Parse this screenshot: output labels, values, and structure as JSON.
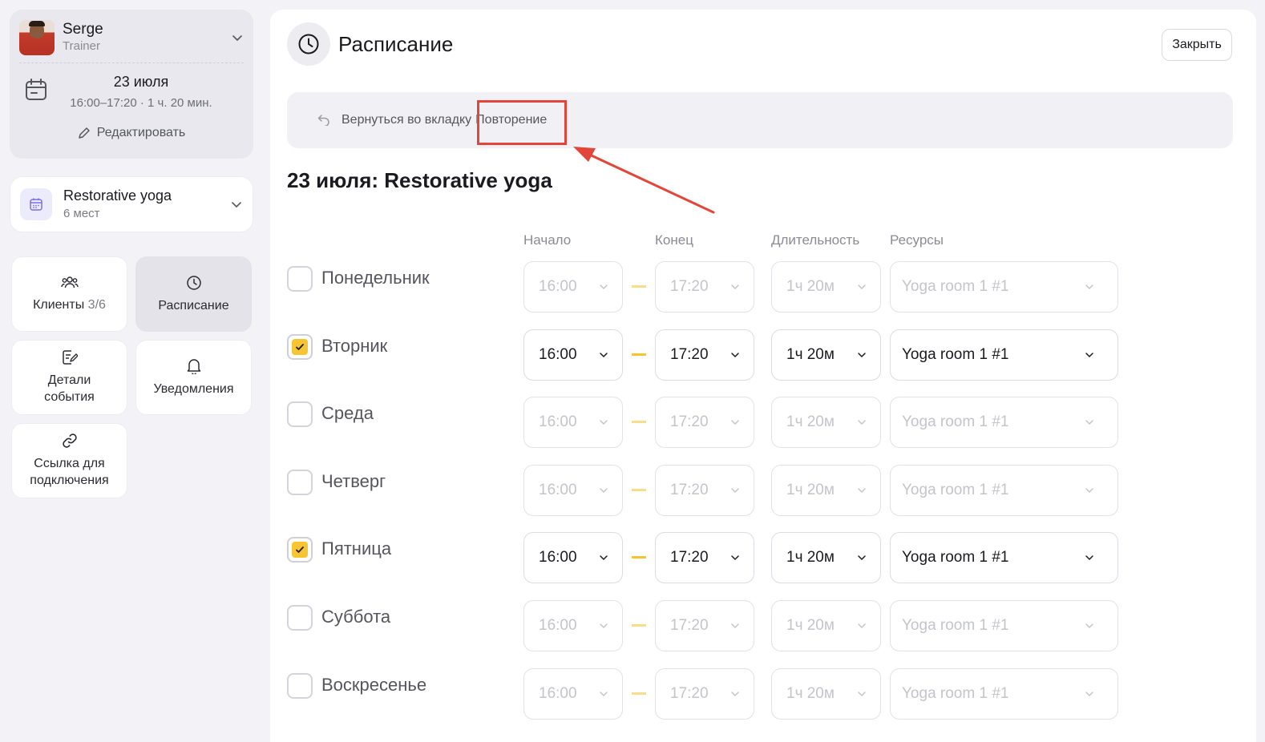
{
  "user": {
    "name": "Serge",
    "role": "Trainer"
  },
  "event": {
    "date": "23 июля",
    "time": "16:00–17:20 · 1 ч. 20 мин.",
    "edit_label": "Редактировать"
  },
  "class_info": {
    "name": "Restorative yoga",
    "seats": "6 мест"
  },
  "tiles": {
    "clients_label": "Клиенты",
    "clients_count": "3/6",
    "schedule_label": "Расписание",
    "details_line1": "Детали",
    "details_line2": "события",
    "notifications_label": "Уведомления",
    "link_line1": "Ссылка для",
    "link_line2": "подключения"
  },
  "header": {
    "title": "Расписание",
    "close_label": "Закрыть"
  },
  "back": {
    "text": "Вернуться во вкладку",
    "link": "Повторение"
  },
  "section_title": "23 июля: Restorative yoga",
  "columns": {
    "start": "Начало",
    "end": "Конец",
    "duration": "Длительность",
    "resources": "Ресурсы"
  },
  "days": [
    {
      "name": "Понедельник",
      "checked": false,
      "start": "16:00",
      "end": "17:20",
      "duration": "1ч 20м",
      "resource": "Yoga room 1 #1"
    },
    {
      "name": "Вторник",
      "checked": true,
      "start": "16:00",
      "end": "17:20",
      "duration": "1ч 20м",
      "resource": "Yoga room 1 #1"
    },
    {
      "name": "Среда",
      "checked": false,
      "start": "16:00",
      "end": "17:20",
      "duration": "1ч 20м",
      "resource": "Yoga room 1 #1"
    },
    {
      "name": "Четверг",
      "checked": false,
      "start": "16:00",
      "end": "17:20",
      "duration": "1ч 20м",
      "resource": "Yoga room 1 #1"
    },
    {
      "name": "Пятница",
      "checked": true,
      "start": "16:00",
      "end": "17:20",
      "duration": "1ч 20м",
      "resource": "Yoga room 1 #1"
    },
    {
      "name": "Суббота",
      "checked": false,
      "start": "16:00",
      "end": "17:20",
      "duration": "1ч 20м",
      "resource": "Yoga room 1 #1"
    },
    {
      "name": "Воскресенье",
      "checked": false,
      "start": "16:00",
      "end": "17:20",
      "duration": "1ч 20м",
      "resource": "Yoga room 1 #1"
    }
  ],
  "colors": {
    "accent_yellow": "#f7c531",
    "annotation_red": "#e2463a",
    "class_icon_purple": "#7b6fe0"
  },
  "icons": {
    "clock": "clock-icon",
    "calendar": "calendar-icon",
    "pencil": "pencil-icon",
    "users": "users-icon",
    "notes": "notes-icon",
    "bell": "bell-icon",
    "link": "link-icon",
    "back": "back-arrow-icon",
    "chevron": "chevron-down-icon",
    "check": "check-icon"
  }
}
